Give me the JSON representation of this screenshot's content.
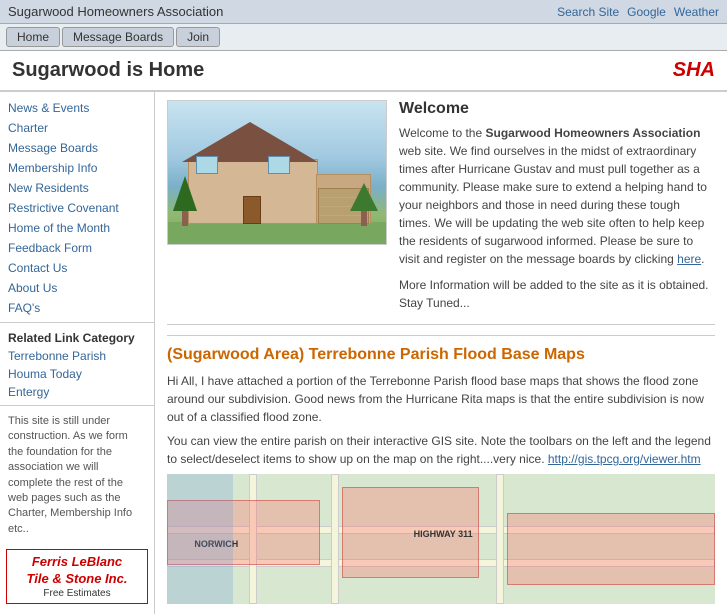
{
  "site": {
    "title": "Sugarwood Homeowners Association",
    "sha_logo": "SHA"
  },
  "top_links": {
    "search": "Search Site",
    "google": "Google",
    "weather": "Weather"
  },
  "nav": {
    "items": [
      {
        "label": "Home"
      },
      {
        "label": "Message Boards"
      },
      {
        "label": "Join"
      }
    ]
  },
  "page_header": {
    "title": "Sugarwood is Home"
  },
  "sidebar": {
    "menu_items": [
      {
        "label": "News & Events"
      },
      {
        "label": "Charter"
      },
      {
        "label": "Message Boards"
      },
      {
        "label": "Membership Info"
      },
      {
        "label": "New Residents"
      },
      {
        "label": "Restrictive Covenant"
      },
      {
        "label": "Home of the Month"
      },
      {
        "label": "Feedback Form"
      },
      {
        "label": "Contact Us"
      },
      {
        "label": "About Us"
      },
      {
        "label": "FAQ's"
      }
    ],
    "related_links_title": "Related Link Category",
    "related_links": [
      {
        "label": "Terrebonne Parish"
      },
      {
        "label": "Houma Today"
      },
      {
        "label": "Entergy"
      }
    ],
    "notice_text": "This site is still under construction. As we form the foundation for the association we will complete the rest of the web pages such as the Charter, Membership Info etc..",
    "sponsor_name": "Ferris LeBlanc\nTile & Stone Inc.",
    "sponsor_sub": "Free Estimates"
  },
  "welcome": {
    "heading": "Welcome",
    "body": "Welcome to the Sugarwood Homeowners Association web site. We find ourselves in the midst of extraordinary times after Hurricane Gustav and must pull together as a community. Please make sure to extend a helping hand to your neighbors and those in need during these tough times. We will be updating the web site often to help keep the residents of sugarwood informed. Please be sure to visit and register on the message boards by clicking",
    "link_text": "here.",
    "more_info": "More Information will be added to the site as it is obtained. Stay Tuned..."
  },
  "flood_section": {
    "heading": "(Sugarwood Area) Terrebonne Parish Flood Base Maps",
    "para1": "Hi All, I have attached a portion of the Terrebonne Parish flood base maps that shows the flood zone around our subdivision.  Good news from the Hurricane Rita maps is that the entire subdivision is now out of a classified flood zone.",
    "para2": "You can view the entire parish on their interactive GIS site.  Note the toolbars on the left and the legend to select/deselect items to show up on the map on the right....very nice.",
    "link_text": "http://gis.tpcg.org/viewer.htm"
  },
  "map_labels": {
    "norwich": "NORWICH",
    "highway311": "HIGHWAY 311"
  }
}
